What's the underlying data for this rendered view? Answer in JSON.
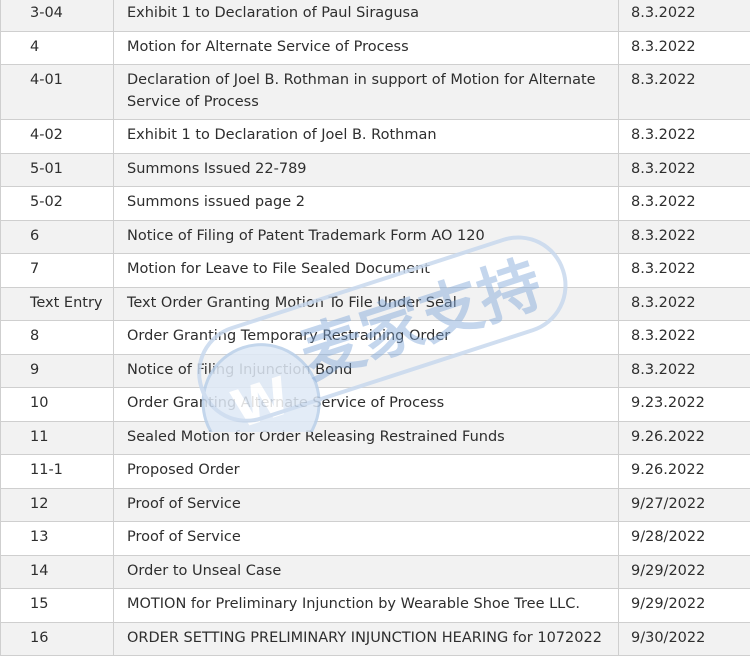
{
  "docket": {
    "rows": [
      {
        "number": "3-04",
        "description": "Exhibit 1 to Declaration of Paul Siragusa",
        "date": "8.3.2022"
      },
      {
        "number": "4",
        "description": "Motion for Alternate Service of Process",
        "date": "8.3.2022"
      },
      {
        "number": "4-01",
        "description": "Declaration of Joel B. Rothman in support of Motion for Alternate Service of Process",
        "date": "8.3.2022"
      },
      {
        "number": "4-02",
        "description": "Exhibit 1 to Declaration of Joel B. Rothman",
        "date": "8.3.2022"
      },
      {
        "number": "5-01",
        "description": "Summons Issued 22-789",
        "date": "8.3.2022"
      },
      {
        "number": "5-02",
        "description": "Summons issued page 2",
        "date": "8.3.2022"
      },
      {
        "number": "6",
        "description": "Notice of Filing of Patent Trademark Form AO 120",
        "date": "8.3.2022"
      },
      {
        "number": "7",
        "description": "Motion for Leave to File Sealed Document",
        "date": "8.3.2022"
      },
      {
        "number": "Text Entry",
        "description": "Text Order Granting Motion To File Under Seal",
        "date": "8.3.2022"
      },
      {
        "number": "8",
        "description": "Order Granting Temporary Restraining Order",
        "date": "8.3.2022"
      },
      {
        "number": "9",
        "description": "Notice of Filing Injunction Bond",
        "date": "8.3.2022"
      },
      {
        "number": "10",
        "description": "Order Granting Alternate Service of Process",
        "date": "9.23.2022"
      },
      {
        "number": "11",
        "description": "Sealed Motion for Order Releasing Restrained Funds",
        "date": "9.26.2022"
      },
      {
        "number": "11-1",
        "description": "Proposed Order",
        "date": "9.26.2022"
      },
      {
        "number": "12",
        "description": "Proof of Service",
        "date": "9/27/2022"
      },
      {
        "number": "13",
        "description": "Proof of Service",
        "date": "9/28/2022"
      },
      {
        "number": "14",
        "description": "Order to Unseal Case",
        "date": "9/29/2022"
      },
      {
        "number": "15",
        "description": "MOTION for Preliminary Injunction by Wearable Shoe Tree LLC.",
        "date": "9/29/2022"
      },
      {
        "number": "16",
        "description": "ORDER SETTING PRELIMINARY INJUNCTION HEARING for 1072022",
        "date": "9/30/2022"
      }
    ]
  },
  "watermark": {
    "text": "麦家支持",
    "logo_text": "W",
    "color": "#7fa8d8"
  }
}
